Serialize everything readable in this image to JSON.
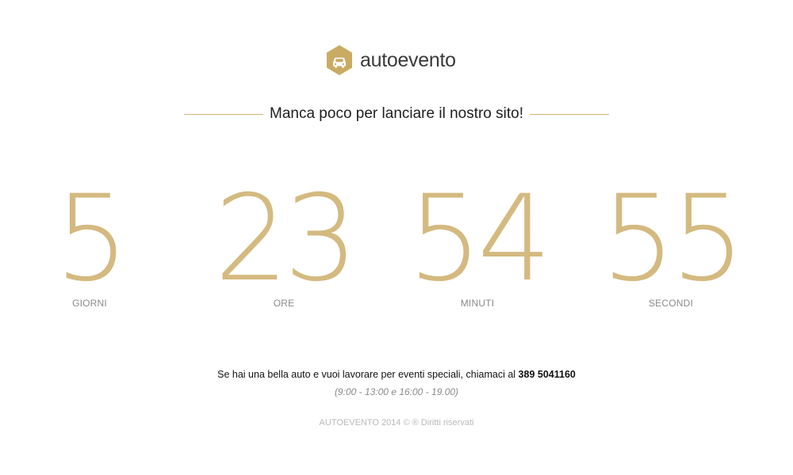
{
  "brand": {
    "name": "autoevento",
    "logo_icon": "car-hexagon-icon",
    "accent_color": "#d4ba80"
  },
  "tagline": "Manca poco per lanciare il nostro sito!",
  "countdown": [
    {
      "value": "5",
      "label": "GIORNI"
    },
    {
      "value": "23",
      "label": "ORE"
    },
    {
      "value": "54",
      "label": "MINUTI"
    },
    {
      "value": "55",
      "label": "SECONDI"
    }
  ],
  "contact": {
    "text": "Se hai una bella auto e vuoi lavorare per eventi speciali, chiamaci al",
    "phone": "389 5041160",
    "hours": "(9:00 - 13:00 e 16:00 - 19.00)"
  },
  "copyright": "AUTOEVENTO 2014 © ® Diritti riservati"
}
